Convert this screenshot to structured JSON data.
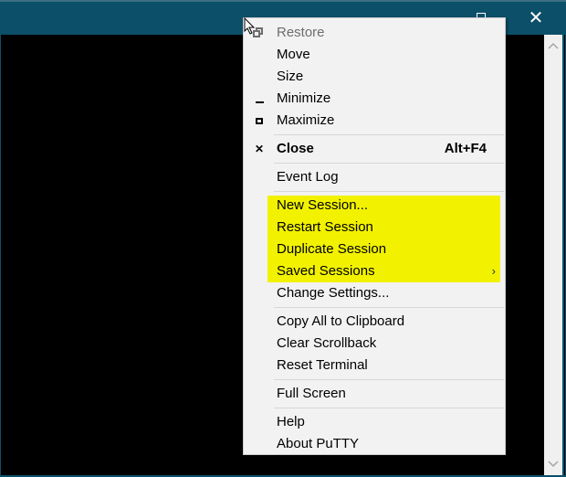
{
  "window": {
    "title_buttons": {
      "minimize": "minimize-icon",
      "maximize": "maximize-icon",
      "close": "✕"
    },
    "scrollbar": {
      "up_arrow": "⌃",
      "down_arrow": "⌄"
    }
  },
  "colors": {
    "titlebar": "#0c4f69",
    "menu_bg": "#f2f2f2",
    "highlight": "#f2f200",
    "terminal_bg": "#000000"
  },
  "menu": {
    "items": [
      {
        "label": "Restore",
        "icon": "restore-icon",
        "disabled": true
      },
      {
        "label": "Move"
      },
      {
        "label": "Size"
      },
      {
        "label": "Minimize",
        "icon": "minimize-icon"
      },
      {
        "label": "Maximize",
        "icon": "maximize-icon"
      },
      {
        "label": "Close",
        "icon": "✕",
        "shortcut": "Alt+F4",
        "bold": true
      },
      {
        "label": "Event Log"
      },
      {
        "label": "New Session..."
      },
      {
        "label": "Restart Session"
      },
      {
        "label": "Duplicate Session"
      },
      {
        "label": "Saved Sessions",
        "submenu": "›"
      },
      {
        "label": "Change Settings..."
      },
      {
        "label": "Copy All to Clipboard"
      },
      {
        "label": "Clear Scrollback"
      },
      {
        "label": "Reset Terminal"
      },
      {
        "label": "Full Screen"
      },
      {
        "label": "Help"
      },
      {
        "label": "About PuTTY"
      }
    ]
  }
}
